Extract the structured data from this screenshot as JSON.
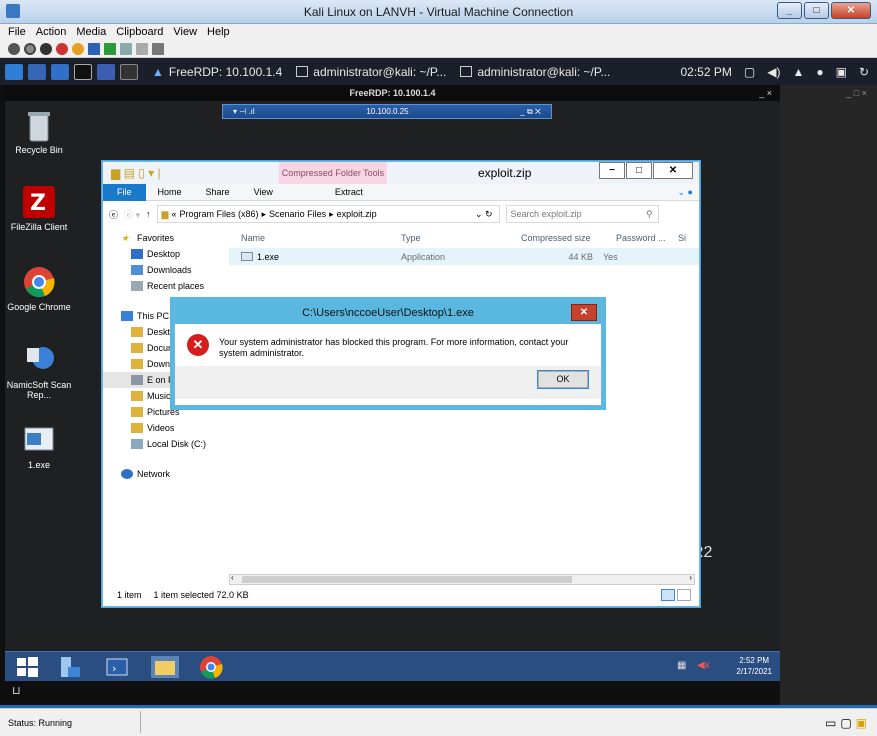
{
  "hyperv": {
    "title": "Kali Linux on LANVH - Virtual Machine Connection",
    "menu": [
      "File",
      "Action",
      "Media",
      "Clipboard",
      "View",
      "Help"
    ],
    "status": "Status: Running"
  },
  "kali_panel": {
    "tasks": [
      "FreeRDP: 10.100.1.4",
      "administrator@kali: ~/P...",
      "administrator@kali: ~/P..."
    ],
    "clock": "02:52 PM"
  },
  "rdp": {
    "header": "FreeRDP: 10.100.1.4",
    "header_controls": "_ ×",
    "right_controls": "_ □ ×",
    "connection_bar": "10.100.0.25"
  },
  "desktop": {
    "icons": [
      {
        "label": "Recycle Bin",
        "icon": "recycle-bin-icon"
      },
      {
        "label": "FileZilla Client",
        "icon": "filezilla-icon"
      },
      {
        "label": "Google Chrome",
        "icon": "chrome-icon"
      },
      {
        "label": "NamicSoft Scan Rep...",
        "icon": "namicsoft-icon"
      },
      {
        "label": "1.exe",
        "icon": "exe-icon"
      }
    ],
    "background_text": "R2"
  },
  "explorer": {
    "title": "exploit.zip",
    "context_tab": "Compressed Folder Tools",
    "ribbon_tabs": [
      "File",
      "Home",
      "Share",
      "View",
      "Extract"
    ],
    "breadcrumb": [
      "«",
      "Program Files (x86)",
      "▸",
      "Scenario Files",
      "▸",
      "exploit.zip"
    ],
    "search_placeholder": "Search exploit.zip",
    "nav": [
      "Favorites",
      "Desktop",
      "Downloads",
      "Recent places",
      "This PC",
      "Deskto",
      "Docum",
      "Downl",
      "E on Pl",
      "Music",
      "Pictures",
      "Videos",
      "Local Disk (C:)",
      "Network"
    ],
    "columns": [
      "Name",
      "Type",
      "Compressed size",
      "Password ...",
      "Si"
    ],
    "rows": [
      {
        "name": "1.exe",
        "type": "Application",
        "compressed_size": "44 KB",
        "password": "Yes"
      }
    ],
    "status_count": "1 item",
    "status_selected": "1 item selected  72.0 KB"
  },
  "dialog": {
    "title": "C:\\Users\\nccoeUser\\Desktop\\1.exe",
    "message": "Your system administrator has blocked this program. For more information, contact your system administrator.",
    "ok_label": "OK"
  },
  "win_taskbar": {
    "time": "2:52 PM",
    "date": "2/17/2021"
  },
  "colors": {
    "kali_panel": "#1b1f2a",
    "win_taskbar": "#2a4d82",
    "dialog_accent": "#5ab7e0",
    "error_red": "#d61d1d"
  }
}
